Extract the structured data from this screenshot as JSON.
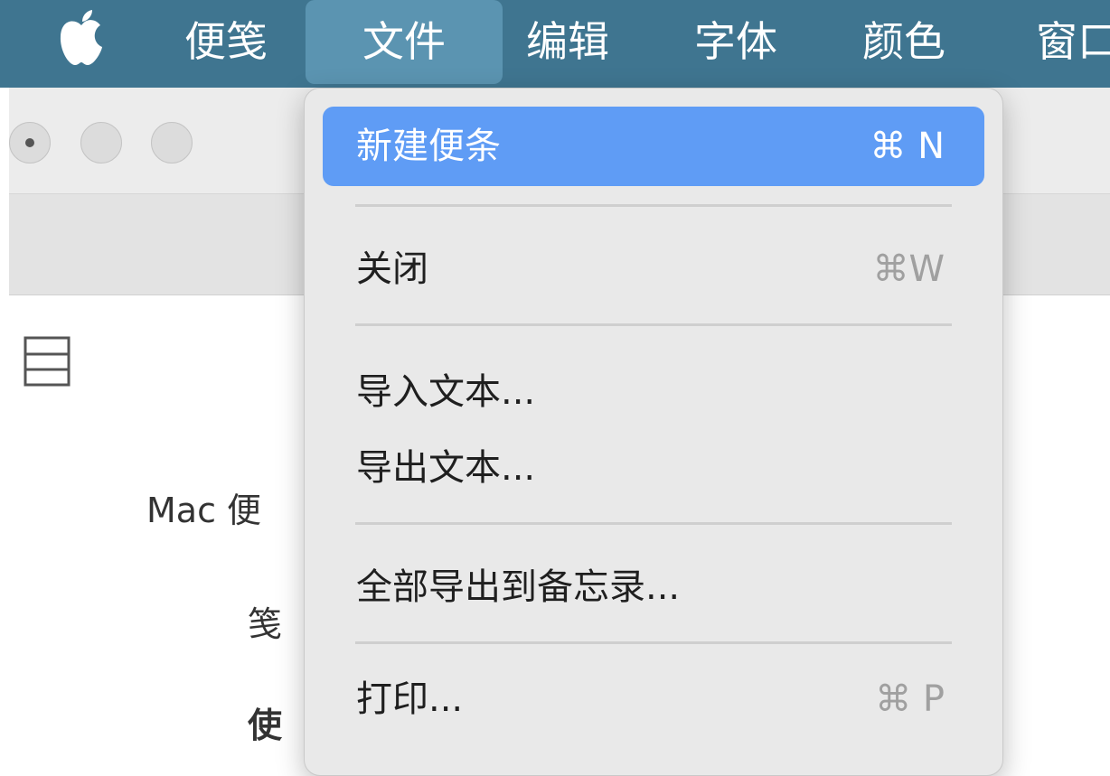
{
  "menubar": {
    "apple_icon": "apple-logo-icon",
    "items": [
      {
        "label": "便笺"
      },
      {
        "label": "文件"
      },
      {
        "label": "编辑"
      },
      {
        "label": "字体"
      },
      {
        "label": "颜色"
      },
      {
        "label": "窗口"
      }
    ],
    "background": "#3f7590",
    "active_background": "#5b94b1"
  },
  "file_menu": {
    "items": [
      {
        "label": "新建便条",
        "shortcut": "⌘ N",
        "highlighted": true
      },
      {
        "label": "关闭",
        "shortcut": "⌘W"
      },
      {
        "label": "导入文本..."
      },
      {
        "label": "导出文本..."
      },
      {
        "label": "全部导出到备忘录..."
      },
      {
        "label": "打印...",
        "shortcut": "⌘ P"
      }
    ],
    "highlight_color": "#5f9cf5"
  },
  "window": {
    "list_icon": "list-view-icon",
    "content_lines": [
      "Mac 便",
      "笺",
      "使"
    ]
  }
}
